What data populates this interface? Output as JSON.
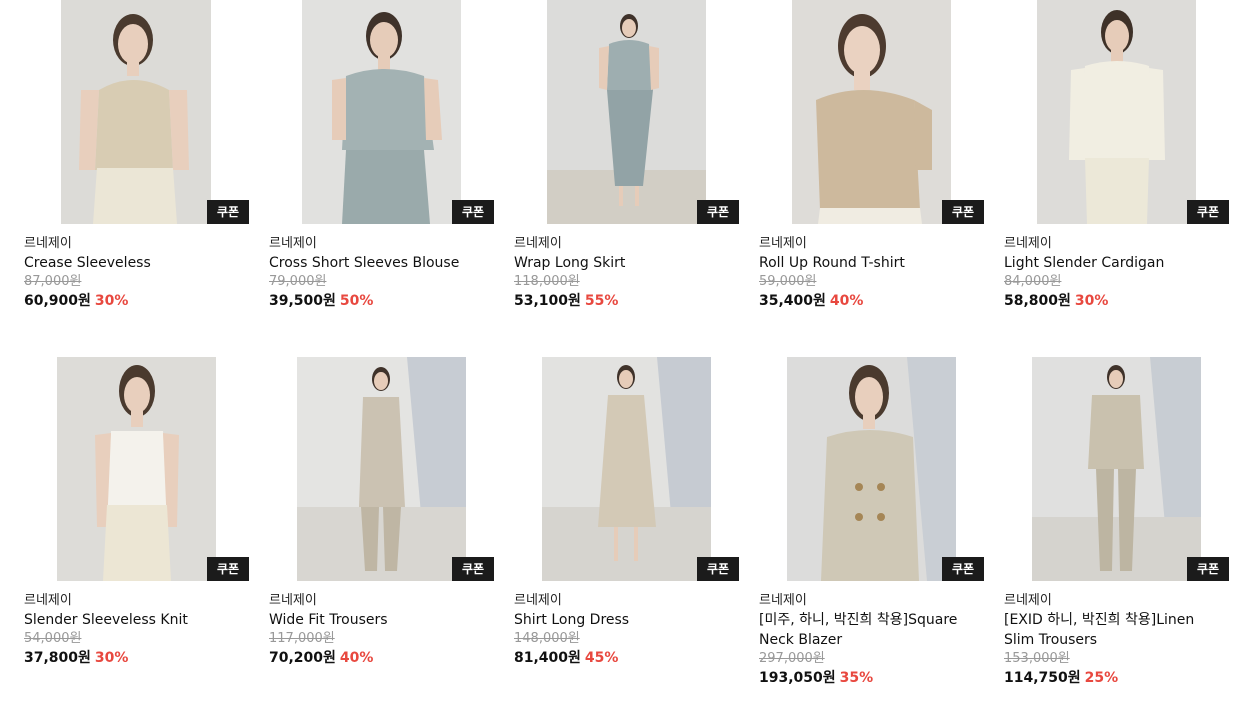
{
  "coupon_label": "쿠폰",
  "colors": {
    "coupon_bg": "#1b1b1b",
    "discount": "#e8483f",
    "strike": "#999999"
  },
  "products": [
    {
      "brand": "르네제이",
      "name": "Crease Sleeveless",
      "original_price": "87,000원",
      "sale_price": "60,900원",
      "discount": "30%",
      "photo": "sleeveless-top-beige"
    },
    {
      "brand": "르네제이",
      "name": "Cross Short Sleeves Blouse",
      "original_price": "79,000원",
      "sale_price": "39,500원",
      "discount": "50%",
      "photo": "wrap-blouse-grey-blue"
    },
    {
      "brand": "르네제이",
      "name": "Wrap Long Skirt",
      "original_price": "118,000원",
      "sale_price": "53,100원",
      "discount": "55%",
      "photo": "full-look-grey-blue"
    },
    {
      "brand": "르네제이",
      "name": "Roll Up Round T-shirt",
      "original_price": "59,000원",
      "sale_price": "35,400원",
      "discount": "40%",
      "photo": "tshirt-beige"
    },
    {
      "brand": "르네제이",
      "name": "Light Slender Cardigan",
      "original_price": "84,000원",
      "sale_price": "58,800원",
      "discount": "30%",
      "photo": "cardigan-ivory"
    },
    {
      "brand": "르네제이",
      "name": "Slender Sleeveless Knit",
      "original_price": "54,000원",
      "sale_price": "37,800원",
      "discount": "30%",
      "photo": "knit-white"
    },
    {
      "brand": "르네제이",
      "name": "Wide Fit Trousers",
      "original_price": "117,000원",
      "sale_price": "70,200원",
      "discount": "40%",
      "photo": "full-look-beige-coat"
    },
    {
      "brand": "르네제이",
      "name": "Shirt Long Dress",
      "original_price": "148,000원",
      "sale_price": "81,400원",
      "discount": "45%",
      "photo": "shirt-dress-beige"
    },
    {
      "brand": "르네제이",
      "name": "[미주, 하니, 박진희 착용]Square Neck Blazer",
      "original_price": "297,000원",
      "sale_price": "193,050원",
      "discount": "35%",
      "photo": "blazer-linen"
    },
    {
      "brand": "르네제이",
      "name": "[EXID 하니, 박진희 착용]Linen Slim Trousers",
      "original_price": "153,000원",
      "sale_price": "114,750원",
      "discount": "25%",
      "photo": "linen-suit"
    }
  ]
}
